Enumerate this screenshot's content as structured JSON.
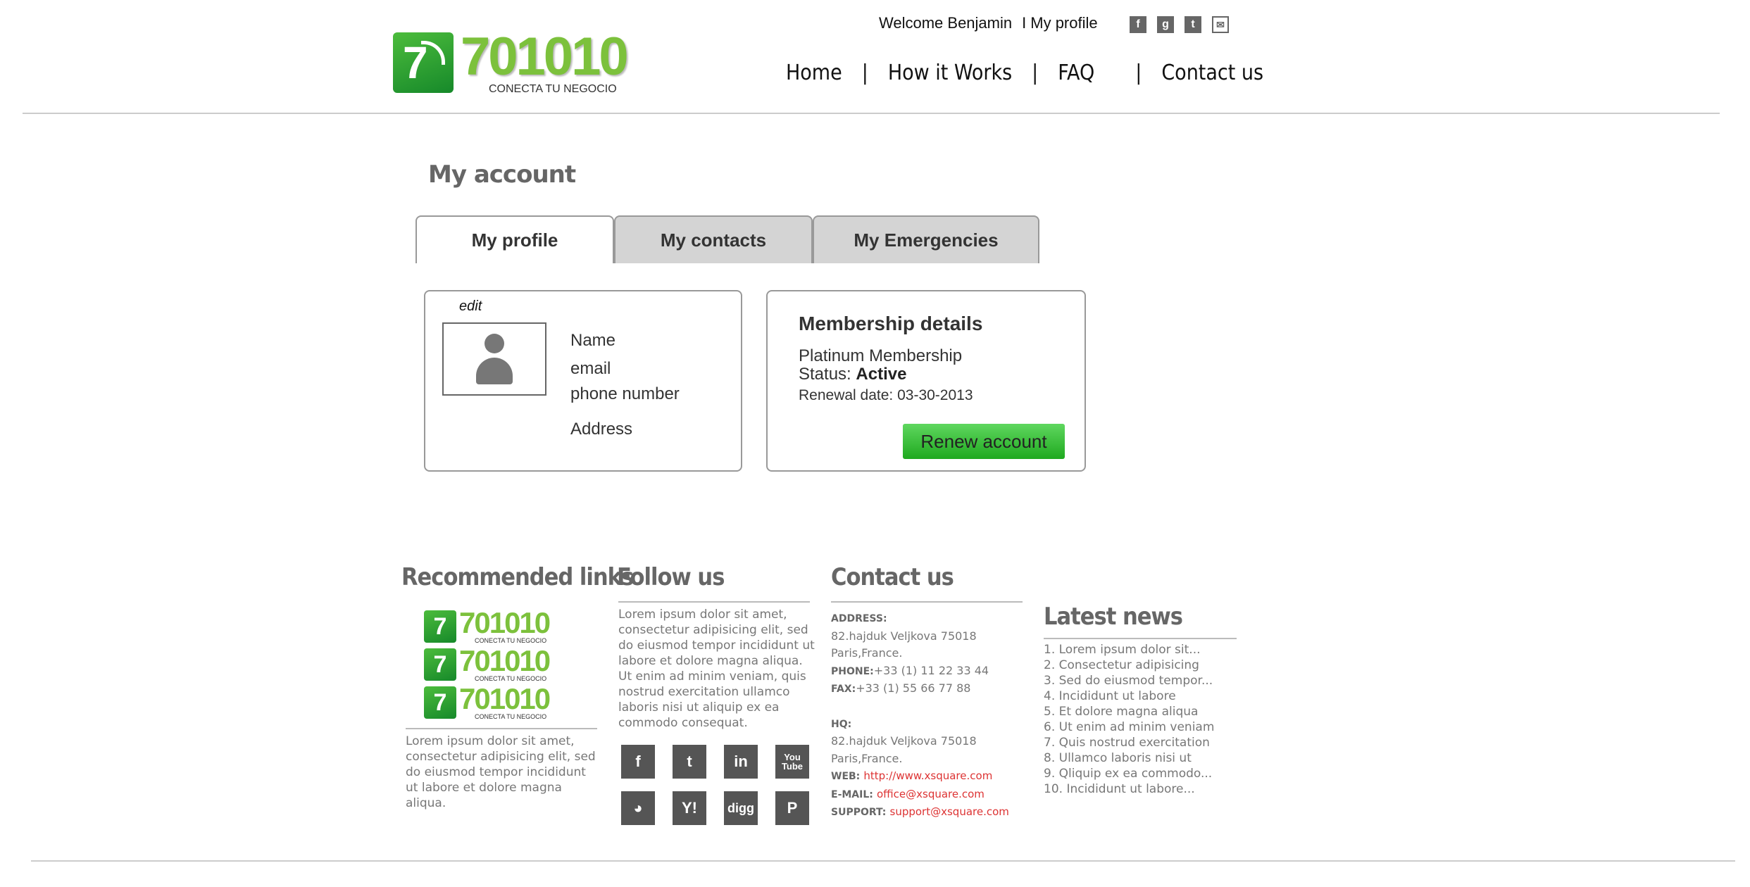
{
  "header": {
    "logo": {
      "number": "701010",
      "tagline": "CONECTA TU NEGOCIO"
    },
    "welcome": "Welcome Benjamin",
    "separator": "I",
    "my_profile_link": "My profile",
    "social_icons": [
      "facebook-icon",
      "google-plus-icon",
      "twitter-icon",
      "mail-icon"
    ],
    "nav": [
      {
        "label": "Home"
      },
      {
        "label": "How it Works"
      },
      {
        "label": "FAQ"
      },
      {
        "label": "Contact us"
      }
    ],
    "nav_divider": "|"
  },
  "account": {
    "title": "My account",
    "tabs": [
      {
        "label": "My profile",
        "active": true
      },
      {
        "label": "My contacts",
        "active": false
      },
      {
        "label": "My Emergencies",
        "active": false
      }
    ],
    "profile": {
      "edit_label": "edit",
      "fields": [
        "Name",
        "email",
        "phone number",
        "Address"
      ]
    },
    "membership": {
      "title": "Membership details",
      "plan": "Platinum Membership",
      "status_label": "Status:",
      "status_value": "Active",
      "renewal": "Renewal date: 03-30-2013",
      "renew_button": "Renew account"
    }
  },
  "footer": {
    "recommended": {
      "title": "Recommended links",
      "logo_number": "701010",
      "logo_tagline": "CONECTA TU NEGOCIO",
      "text": "Lorem ipsum dolor sit amet, consectetur adipisicing elit, sed do eiusmod tempor incididunt ut labore et dolore magna aliqua."
    },
    "follow": {
      "title": "Follow us",
      "text": "Lorem ipsum dolor sit amet, consectetur adipisicing elit, sed do eiusmod tempor incididunt ut labore et dolore magna aliqua. Ut enim ad minim veniam, quis nostrud exercitation ullamco laboris nisi ut aliquip ex ea commodo consequat.",
      "icons": [
        {
          "name": "facebook-icon",
          "glyph": "f"
        },
        {
          "name": "twitter-icon",
          "glyph": "t"
        },
        {
          "name": "linkedin-icon",
          "glyph": "in"
        },
        {
          "name": "youtube-icon",
          "glyph": "You Tube"
        },
        {
          "name": "rss-icon",
          "glyph": "◕"
        },
        {
          "name": "yahoo-icon",
          "glyph": "Y!"
        },
        {
          "name": "digg-icon",
          "glyph": "digg"
        },
        {
          "name": "pinterest-icon",
          "glyph": "P"
        }
      ]
    },
    "contact": {
      "title": "Contact us",
      "address_label": "ADDRESS:",
      "address_line1": "82.hajduk Veljkova 75018",
      "address_line2": "Paris,France.",
      "phone_label": "PHONE:",
      "phone": "+33 (1) 11 22 33 44",
      "fax_label": "FAX:",
      "fax": "+33 (1) 55 66 77 88",
      "hq_label": "HQ:",
      "hq_line1": "82.hajduk Veljkova 75018",
      "hq_line2": "Paris,France.",
      "web_label": "WEB:",
      "web": "http://www.xsquare.com",
      "email_label": "E-MAIL:",
      "email": "office@xsquare.com",
      "support_label": "SUPPORT:",
      "support": "support@xsquare.com"
    },
    "news": {
      "title": "Latest news",
      "items": [
        "1. Lorem ipsum dolor sit...",
        "2. Consectetur adipisicing",
        "3. Sed do eiusmod tempor...",
        "4. Incididunt ut labore",
        "5. Et dolore magna aliqua",
        "6. Ut enim ad minim veniam",
        "7. Quis nostrud exercitation",
        "8. Ullamco laboris nisi ut",
        "9. Qliquip ex ea commodo...",
        "10. Incididunt ut labore..."
      ]
    }
  },
  "colors": {
    "brand_green": "#7cc13c",
    "badge_green": "#16892a",
    "button_green": "#1fa91f",
    "link_red": "#d33"
  }
}
